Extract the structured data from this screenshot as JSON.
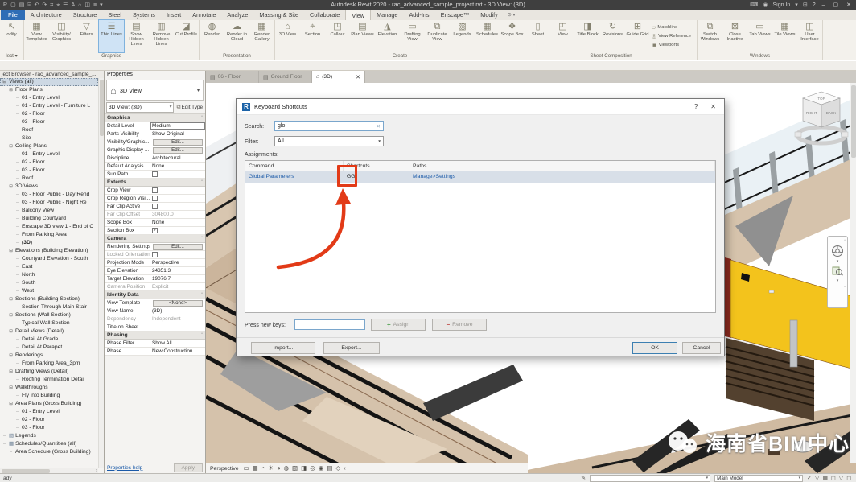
{
  "colors": {
    "accent_red": "#e23a17",
    "selection_blue": "#d8dfe8",
    "link_blue": "#1b5aa8",
    "ribbon_highlight": "#cfe3f5",
    "yellow_wall": "#f3c31c"
  },
  "title_bar": {
    "qat": [
      {
        "name": "revit-logo",
        "glyph": "R"
      },
      {
        "name": "new-file",
        "glyph": "▢"
      },
      {
        "name": "open-file",
        "glyph": "▤"
      },
      {
        "name": "save",
        "glyph": "⌸"
      },
      {
        "name": "undo",
        "glyph": "↶"
      },
      {
        "name": "redo",
        "glyph": "↷"
      },
      {
        "name": "print",
        "glyph": "⌗"
      },
      {
        "name": "measure",
        "glyph": "⌖"
      },
      {
        "name": "aligned-dimension",
        "glyph": "☰"
      },
      {
        "name": "text",
        "glyph": "A"
      },
      {
        "name": "3d-view",
        "glyph": "⌂"
      },
      {
        "name": "section",
        "glyph": "◫"
      },
      {
        "name": "thin-lines",
        "glyph": "≡"
      },
      {
        "name": "qat-customize",
        "glyph": "▾"
      }
    ],
    "title": "Autodesk Revit 2020 - rac_advanced_sample_project.rvt - 3D View: (3D)",
    "keyboard_glyph": "⌨",
    "avatar_glyph": "◉",
    "sign_in": "Sign In",
    "caret_glyph": "▾",
    "cart_glyph": "⊞",
    "help_glyph": "?",
    "win_min": "–",
    "win_max": "▢",
    "win_close": "✕"
  },
  "ribbon": {
    "tabs": [
      {
        "label": "File",
        "file": true
      },
      {
        "label": "Architecture"
      },
      {
        "label": "Structure"
      },
      {
        "label": "Steel"
      },
      {
        "label": "Systems"
      },
      {
        "label": "Insert"
      },
      {
        "label": "Annotate"
      },
      {
        "label": "Analyze"
      },
      {
        "label": "Massing & Site"
      },
      {
        "label": "Collaborate"
      },
      {
        "label": "View",
        "active": true
      },
      {
        "label": "Manage"
      },
      {
        "label": "Add-Ins"
      },
      {
        "label": "Enscape™"
      },
      {
        "label": "Modify"
      }
    ],
    "state_toggle": "⊙ ▾",
    "select": {
      "modify_glyph": "↖",
      "modify_label": "odify",
      "panel_label": "lect ▾"
    },
    "groups": [
      {
        "label": "Graphics",
        "buttons": [
          {
            "label": "View Templates",
            "icon": "view-templates",
            "glyph": "▦"
          },
          {
            "label": "Visibility/ Graphics",
            "icon": "visibility-graphics",
            "glyph": "◫"
          },
          {
            "label": "Filters",
            "icon": "filters",
            "glyph": "▽"
          },
          {
            "label": "Thin Lines",
            "icon": "thin-lines",
            "glyph": "☰",
            "highlight": true
          },
          {
            "label": "Show Hidden Lines",
            "icon": "show-hidden-lines",
            "glyph": "▤"
          },
          {
            "label": "Remove Hidden Lines",
            "icon": "remove-hidden-lines",
            "glyph": "▥"
          },
          {
            "label": "Cut Profile",
            "icon": "cut-profile",
            "glyph": "◪"
          }
        ]
      },
      {
        "label": "Presentation",
        "buttons": [
          {
            "label": "Render",
            "icon": "render",
            "glyph": "◍"
          },
          {
            "label": "Render in Cloud",
            "icon": "render-in-cloud",
            "glyph": "☁"
          },
          {
            "label": "Render Gallery",
            "icon": "render-gallery",
            "glyph": "▦"
          }
        ]
      },
      {
        "label": "Create",
        "buttons": [
          {
            "label": "3D View",
            "icon": "3d-view",
            "glyph": "⌂"
          },
          {
            "label": "Section",
            "icon": "section",
            "glyph": "⌖"
          },
          {
            "label": "Callout",
            "icon": "callout",
            "glyph": "◳"
          },
          {
            "label": "Plan Views",
            "icon": "plan-views",
            "glyph": "▤"
          },
          {
            "label": "Elevation",
            "icon": "elevation",
            "glyph": "◮"
          },
          {
            "label": "Drafting View",
            "icon": "drafting-view",
            "glyph": "▭"
          },
          {
            "label": "Duplicate View",
            "icon": "duplicate-view",
            "glyph": "⧉"
          },
          {
            "label": "Legends",
            "icon": "legends",
            "glyph": "▧"
          },
          {
            "label": "Schedules",
            "icon": "schedules",
            "glyph": "▦"
          },
          {
            "label": "Scope Box",
            "icon": "scope-box",
            "glyph": "❖"
          }
        ]
      },
      {
        "label": "Sheet Composition",
        "buttons": [
          {
            "label": "Sheet",
            "icon": "sheet",
            "glyph": "▯"
          },
          {
            "label": "View",
            "icon": "view",
            "glyph": "◰"
          },
          {
            "label": "Title Block",
            "icon": "title-block",
            "glyph": "◨"
          },
          {
            "label": "Revisions",
            "icon": "revisions",
            "glyph": "↻"
          },
          {
            "label": "Guide Grid",
            "icon": "guide-grid",
            "glyph": "⊞"
          }
        ],
        "small": [
          {
            "label": "Matchline",
            "icon": "matchline",
            "glyph": "▱"
          },
          {
            "label": "View Reference",
            "icon": "view-reference",
            "glyph": "◎"
          },
          {
            "label": "Viewports",
            "icon": "viewports",
            "glyph": "▣"
          }
        ]
      },
      {
        "label": "Windows",
        "buttons": [
          {
            "label": "Switch Windows",
            "icon": "switch-windows",
            "glyph": "⧉"
          },
          {
            "label": "Close Inactive",
            "icon": "close-inactive",
            "glyph": "⊠"
          },
          {
            "label": "Tab Views",
            "icon": "tab-views",
            "glyph": "▭"
          },
          {
            "label": "Tile Views",
            "icon": "tile-views",
            "glyph": "▦"
          },
          {
            "label": "User Interface",
            "icon": "user-interface",
            "glyph": "◫"
          }
        ]
      }
    ]
  },
  "project_browser": {
    "title": "ject Browser - rac_advanced_sample_...",
    "expander_glyph": "⊟",
    "leaf_glyph": "–",
    "icon_glyphs": {
      "legend": "▧",
      "schedule": "▦"
    },
    "items": [
      {
        "label": "Views (all)",
        "lvl": 0,
        "expand": true,
        "selected": true
      },
      {
        "label": "Floor Plans",
        "lvl": 1,
        "expand": true
      },
      {
        "label": "01 - Entry Level",
        "lvl": 2
      },
      {
        "label": "01 - Entry Level - Furniture L",
        "lvl": 2
      },
      {
        "label": "02 - Floor",
        "lvl": 2
      },
      {
        "label": "03 - Floor",
        "lvl": 2
      },
      {
        "label": "Roof",
        "lvl": 2
      },
      {
        "label": "Site",
        "lvl": 2
      },
      {
        "label": "Ceiling Plans",
        "lvl": 1,
        "expand": true
      },
      {
        "label": "01 - Entry Level",
        "lvl": 2
      },
      {
        "label": "02 - Floor",
        "lvl": 2
      },
      {
        "label": "03 - Floor",
        "lvl": 2
      },
      {
        "label": "Roof",
        "lvl": 2
      },
      {
        "label": "3D Views",
        "lvl": 1,
        "expand": true
      },
      {
        "label": "03 - Floor Public - Day Rend",
        "lvl": 2
      },
      {
        "label": "03 - Floor Public - Night Re",
        "lvl": 2
      },
      {
        "label": "Balcony View",
        "lvl": 2
      },
      {
        "label": "Building Courtyard",
        "lvl": 2
      },
      {
        "label": "Enscape 3D view 1 - End of C",
        "lvl": 2
      },
      {
        "label": "From Parking Area",
        "lvl": 2
      },
      {
        "label": "(3D)",
        "lvl": 2,
        "bold": true
      },
      {
        "label": "Elevations (Building Elevation)",
        "lvl": 1,
        "expand": true
      },
      {
        "label": "Courtyard Elevation - South",
        "lvl": 2
      },
      {
        "label": "East",
        "lvl": 2
      },
      {
        "label": "North",
        "lvl": 2
      },
      {
        "label": "South",
        "lvl": 2
      },
      {
        "label": "West",
        "lvl": 2
      },
      {
        "label": "Sections (Building Section)",
        "lvl": 1,
        "expand": true
      },
      {
        "label": "Section Through Main Stair",
        "lvl": 2
      },
      {
        "label": "Sections (Wall Section)",
        "lvl": 1,
        "expand": true
      },
      {
        "label": "Typical Wall Section",
        "lvl": 2
      },
      {
        "label": "Detail Views (Detail)",
        "lvl": 1,
        "expand": true
      },
      {
        "label": "Detail At Grade",
        "lvl": 2
      },
      {
        "label": "Detail At Parapet",
        "lvl": 2
      },
      {
        "label": "Renderings",
        "lvl": 1,
        "expand": true
      },
      {
        "label": "From Parking Area_3pm",
        "lvl": 2
      },
      {
        "label": "Drafting Views (Detail)",
        "lvl": 1,
        "expand": true
      },
      {
        "label": "Roofing Termination Detail",
        "lvl": 2
      },
      {
        "label": "Walkthroughs",
        "lvl": 1,
        "expand": true
      },
      {
        "label": "Fly into Building",
        "lvl": 2
      },
      {
        "label": "Area Plans (Gross Building)",
        "lvl": 1,
        "expand": true
      },
      {
        "label": "01 - Entry Level",
        "lvl": 2
      },
      {
        "label": "02 - Floor",
        "lvl": 2
      },
      {
        "label": "03 - Floor",
        "lvl": 2
      },
      {
        "label": "Legends",
        "lvl": 0,
        "icon": "legend"
      },
      {
        "label": "Schedules/Quantities (all)",
        "lvl": 0,
        "icon": "schedule"
      },
      {
        "label": "Area Schedule (Gross Building)",
        "lvl": 1
      }
    ],
    "h_scroll_arrow": "›"
  },
  "properties": {
    "title": "Properties",
    "type_icon_glyph": "⌂",
    "type_label": "3D View",
    "type_caret": "▾",
    "view_selector": "3D View: (3D)",
    "view_caret": "▾",
    "edit_type_glyph": "⧉",
    "edit_type_label": "Edit Type",
    "collapse_glyph": "ˆ",
    "check_glyph": "✓",
    "sections": [
      {
        "header": "Graphics",
        "rows": [
          {
            "label": "Detail Level",
            "value": "Medium",
            "boxed": true
          },
          {
            "label": "Parts Visibility",
            "value": "Show Original"
          },
          {
            "label": "Visibility/Graphic...",
            "kind": "button",
            "value": "Edit..."
          },
          {
            "label": "Graphic Display ...",
            "kind": "button",
            "value": "Edit..."
          },
          {
            "label": "Discipline",
            "value": "Architectural"
          },
          {
            "label": "Default Analysis ...",
            "value": "None"
          },
          {
            "label": "Sun Path",
            "kind": "checkbox",
            "checked": false
          }
        ]
      },
      {
        "header": "Extents",
        "rows": [
          {
            "label": "Crop View",
            "kind": "checkbox",
            "checked": false
          },
          {
            "label": "Crop Region Visi...",
            "kind": "checkbox",
            "checked": false
          },
          {
            "label": "Far Clip Active",
            "kind": "checkbox",
            "checked": false
          },
          {
            "label": "Far Clip Offset",
            "value": "304800.0",
            "muted": true
          },
          {
            "label": "Scope Box",
            "value": "None"
          },
          {
            "label": "Section Box",
            "kind": "checkbox",
            "checked": true
          }
        ]
      },
      {
        "header": "Camera",
        "rows": [
          {
            "label": "Rendering Settings",
            "kind": "button",
            "value": "Edit..."
          },
          {
            "label": "Locked Orientation",
            "kind": "checkbox",
            "checked": false,
            "muted": true
          },
          {
            "label": "Projection Mode",
            "value": "Perspective"
          },
          {
            "label": "Eye Elevation",
            "value": "24351.3"
          },
          {
            "label": "Target Elevation",
            "value": "19076.7"
          },
          {
            "label": "Camera Position",
            "value": "Explicit",
            "muted": true
          }
        ]
      },
      {
        "header": "Identity Data",
        "rows": [
          {
            "label": "View Template",
            "kind": "button",
            "value": "<None>"
          },
          {
            "label": "View Name",
            "value": "(3D)"
          },
          {
            "label": "Dependency",
            "value": "Independent",
            "muted": true
          },
          {
            "label": "Title on Sheet",
            "value": ""
          }
        ]
      },
      {
        "header": "Phasing",
        "rows": [
          {
            "label": "Phase Filter",
            "value": "Show All"
          },
          {
            "label": "Phase",
            "value": "New Construction"
          }
        ]
      }
    ],
    "help_label": "Properties help",
    "apply_label": "Apply"
  },
  "canvas": {
    "tabs": [
      {
        "label": "06 - Floor",
        "icon_glyph": "▤",
        "icon": "floor-plan"
      },
      {
        "label": "Ground Floor",
        "icon_glyph": "▤",
        "icon": "floor-plan"
      },
      {
        "label": "(3D)",
        "icon_glyph": "⌂",
        "icon": "3d-view",
        "active": true,
        "closable": true
      }
    ],
    "tab_close_glyph": "✕",
    "viewcube": {
      "top": "TOP",
      "right": "RIGHT",
      "back": "BACK"
    },
    "view_control_label": "Perspective",
    "view_control_icons": [
      {
        "name": "scale",
        "glyph": "▭"
      },
      {
        "name": "detail-level",
        "glyph": "▦"
      },
      {
        "name": "visual-style",
        "glyph": "◔"
      },
      {
        "name": "sun-path",
        "glyph": "☀"
      },
      {
        "name": "shadows",
        "glyph": "◑"
      },
      {
        "name": "render-dialog",
        "glyph": "◍"
      },
      {
        "name": "crop-view",
        "glyph": "▧"
      },
      {
        "name": "crop-region",
        "glyph": "◨"
      },
      {
        "name": "temporary-hide-isolate",
        "glyph": "◎"
      },
      {
        "name": "reveal-hidden",
        "glyph": "◉"
      },
      {
        "name": "temporary-view-properties",
        "glyph": "▤"
      },
      {
        "name": "displacement",
        "glyph": "◇"
      },
      {
        "name": "collapse",
        "glyph": "‹"
      }
    ],
    "watermark": "海南省BIM中心"
  },
  "dialog": {
    "icon_glyph": "R",
    "title": "Keyboard Shortcuts",
    "help_glyph": "?",
    "close_glyph": "✕",
    "search_label": "Search:",
    "search_value": "glo",
    "search_clear_glyph": "✕",
    "filter_label": "Filter:",
    "filter_value": "All",
    "filter_caret": "▾",
    "assignments_label": "Assignments:",
    "columns": [
      "Command",
      "Shortcuts",
      "Paths"
    ],
    "rows": [
      {
        "command": "Global Parameters",
        "shortcut": "GG",
        "path": "Manage>Settings",
        "selected": true
      }
    ],
    "press_label": "Press new keys:",
    "assign_glyph": "+",
    "assign_label": "Assign",
    "remove_glyph": "−",
    "remove_label": "Remove",
    "import_label": "Import...",
    "export_label": "Export...",
    "ok_label": "OK",
    "cancel_label": "Cancel"
  },
  "status_bar": {
    "left": "ady",
    "edit_glyph": "✎",
    "design_option_value": "",
    "caret": "▾",
    "main_model": "Main Model",
    "right_icons": [
      {
        "name": "filter-check",
        "glyph": "✓"
      },
      {
        "name": "filter-funnel",
        "glyph": "▽"
      },
      {
        "name": "select-elements",
        "glyph": "▦"
      },
      {
        "name": "select-links",
        "glyph": "◻"
      },
      {
        "name": "select-pinned",
        "glyph": "▽"
      },
      {
        "name": "select-underlay",
        "glyph": "◻"
      }
    ]
  }
}
